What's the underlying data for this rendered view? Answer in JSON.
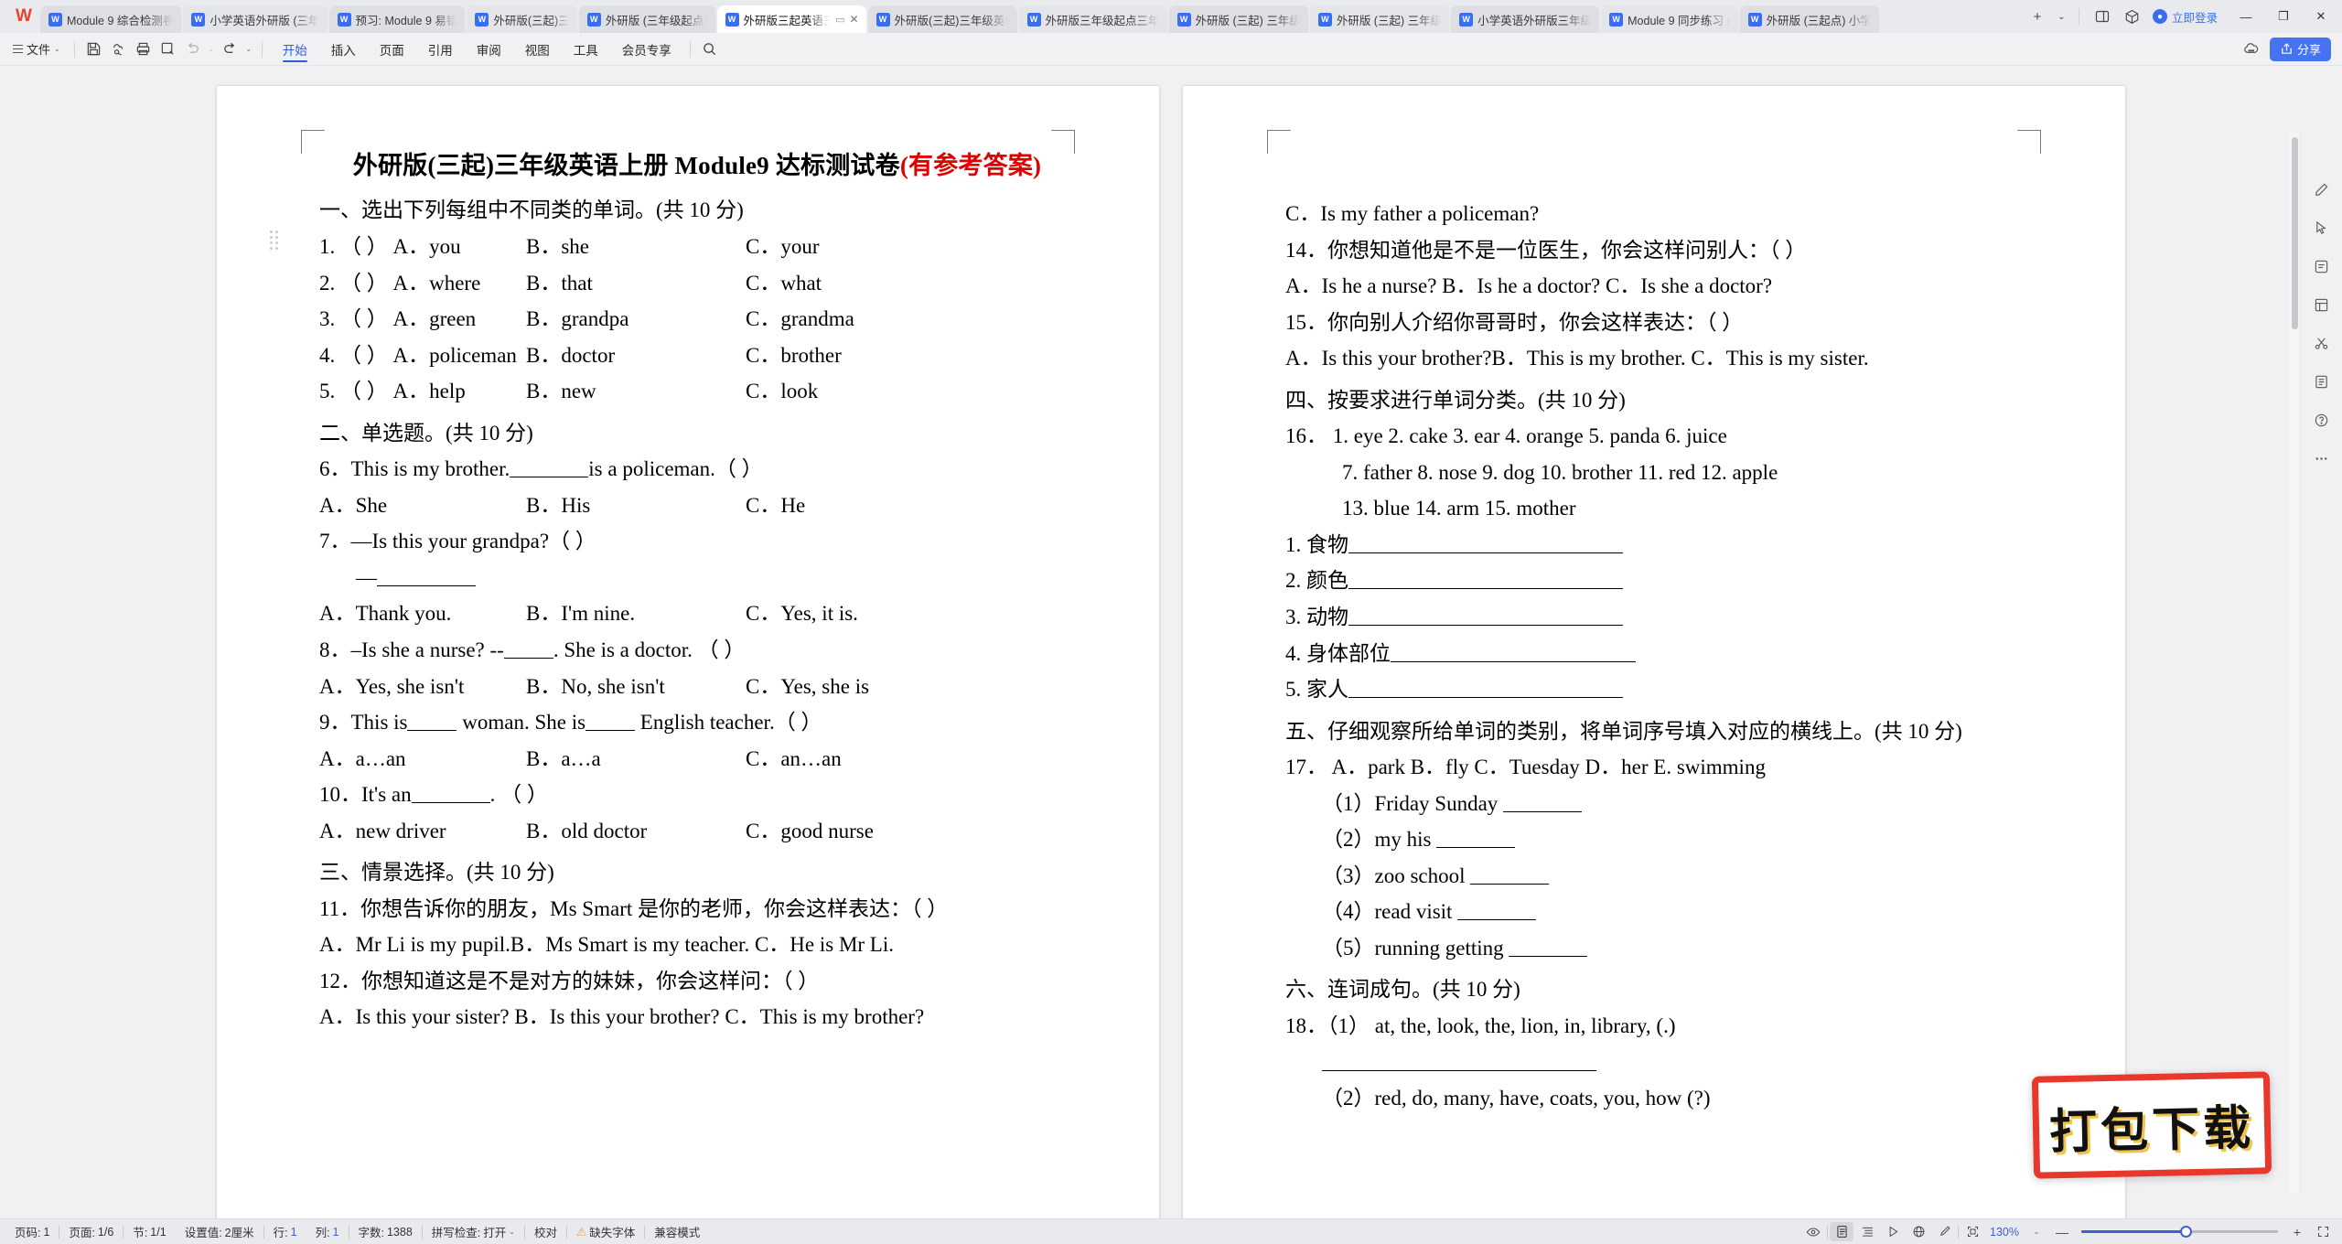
{
  "app": {
    "logo": "W"
  },
  "tabbar": {
    "tabs": [
      {
        "label": "Module 9 综合检测卷",
        "icon": "word-doc-icon",
        "active": false
      },
      {
        "label": "小学英语外研版 (三年",
        "icon": "word-doc-icon",
        "active": false
      },
      {
        "label": "预习: Module 9 易错",
        "icon": "word-doc-icon",
        "active": false
      },
      {
        "label": "外研版(三起)三",
        "icon": "word-doc-icon",
        "active": false
      },
      {
        "label": "外研版 (三年级起点)",
        "icon": "word-doc-icon",
        "active": false
      },
      {
        "label": "外研版三起英语三年",
        "icon": "word-doc-icon",
        "active": true
      },
      {
        "label": "外研版(三起)三年级英语",
        "icon": "word-doc-icon",
        "active": false
      },
      {
        "label": "外研版三年级起点三年",
        "icon": "word-doc-icon",
        "active": false
      },
      {
        "label": "外研版 (三起) 三年级",
        "icon": "word-doc-icon",
        "active": false
      },
      {
        "label": "外研版 (三起) 三年级",
        "icon": "word-doc-icon",
        "active": false
      },
      {
        "label": "小学英语外研版三年级",
        "icon": "word-doc-icon",
        "active": false
      },
      {
        "label": "Module 9 同步练习 (",
        "icon": "word-doc-icon",
        "active": false
      },
      {
        "label": "外研版 (三起点) 小学",
        "icon": "word-doc-icon",
        "active": false
      }
    ],
    "new_tab": "+",
    "new_tab_caret": "⌄",
    "login_label": "立即登录",
    "minimize": "—",
    "restore": "❐",
    "close": "✕"
  },
  "ribbon": {
    "file_label": "文件",
    "menus": [
      {
        "label": "开始",
        "active": true
      },
      {
        "label": "插入",
        "active": false
      },
      {
        "label": "页面",
        "active": false
      },
      {
        "label": "引用",
        "active": false
      },
      {
        "label": "审阅",
        "active": false
      },
      {
        "label": "视图",
        "active": false
      },
      {
        "label": "工具",
        "active": false
      },
      {
        "label": "会员专享",
        "active": false
      }
    ],
    "share_label": "分享"
  },
  "document": {
    "title_main": "外研版(三起)三年级英语上册 Module9 达标测试卷",
    "title_answer": "(有参考答案)",
    "left_page": {
      "section1_head": "一、选出下列每组中不同类的单词。(共 10 分)",
      "q1": {
        "num": "1.",
        "paren": "（    ）",
        "a": "A．you",
        "b": "B．she",
        "c": "C．your"
      },
      "q2": {
        "num": "2.",
        "paren": "（ ）",
        "a": "A．where",
        "b": "B．that",
        "c": "C．what"
      },
      "q3": {
        "num": "3.",
        "paren": "（    ）",
        "a": "A．green",
        "b": "B．grandpa",
        "c": "C．grandma"
      },
      "q4": {
        "num": "4.",
        "paren": "（    ）",
        "a": "A．policeman",
        "b": "B．doctor",
        "c": "C．brother"
      },
      "q5": {
        "num": "5.",
        "paren": "（    ）",
        "a": "A．help",
        "b": "B．new",
        "c": "C．look"
      },
      "section2_head": "二、单选题。(共 10 分)",
      "q6_stem_a": "6．This is my brother.",
      "q6_stem_b": "is a policeman.（     ）",
      "q6_a": "A．She",
      "q6_b": "B．His",
      "q6_c": "C．He",
      "q7_stem": "7．—Is this your grandpa?（ ）",
      "q7_dash": "—",
      "q7_a": "A．Thank you.",
      "q7_b": "B．I'm nine.",
      "q7_c": "C．Yes, it is.",
      "q8_stem_a": "8．–Is she a nurse? --",
      "q8_stem_b": ". She is a doctor. （   ）",
      "q8_a": "A．Yes, she isn't",
      "q8_b": "B．No, she isn't",
      "q8_c": "C．Yes, she is",
      "q9_stem_a": "9．This is",
      "q9_stem_b": "woman. She is",
      "q9_stem_c": "English teacher.（    ）",
      "q9_a": "A．a…an",
      "q9_b": "B．a…a",
      "q9_c": "C．an…an",
      "q10_stem_a": "10．It's an",
      "q10_stem_b": ".  （    ）",
      "q10_a": "A．new driver",
      "q10_b": "B．old doctor",
      "q10_c": "C．good nurse",
      "section3_head": "三、情景选择。(共 10 分)",
      "q11_stem": "11．你想告诉你的朋友，Ms Smart 是你的老师，你会这样表达：（ ）",
      "q11_opts": "A．Mr Li is my pupil.B．Ms Smart is my teacher. C．He is Mr Li.",
      "q12_stem": "12．你想知道这是不是对方的妹妹，你会这样问：（ ）",
      "q12_opts": "A．Is this your sister? B．Is this your brother? C．This is my brother?"
    },
    "right_page": {
      "q13_c": "C．Is my father a policeman?",
      "q14_stem": "14．你想知道他是不是一位医生，你会这样问别人：（ ）",
      "q14_opts": "A．Is he a nurse?   B．Is he a doctor?    C．Is she a doctor?",
      "q15_stem": "15．你向别人介绍你哥哥时，你会这样表达：（ ）",
      "q15_opts": "A．Is this your brother?B．This is my brother. C．This is my sister.",
      "section4_head": "四、按要求进行单词分类。(共 10 分)",
      "q16_num": "16．",
      "q16_row1": "1. eye      2. cake    3. ear     4. orange     5. panda  6. juice",
      "q16_row2": "7. father   8. nose    9. dog   10. brother    11. red    12. apple",
      "q16_row3": "13. blue   14. arm   15. mother",
      "cat1": "1. 食物",
      "cat2": "2. 颜色",
      "cat3": "3. 动物",
      "cat4": "4. 身体部位",
      "cat5": "5. 家人",
      "section5_head": "五、仔细观察所给单词的类别，将单词序号填入对应的横线上。(共 10 分)",
      "q17_stem": "17．  A．park   B．fly   C．Tuesday   D．her   E. swimming",
      "q17_1": "（1）Friday Sunday",
      "q17_2": "（2）my his",
      "q17_3": "（3）zoo school",
      "q17_4": "（4）read visit",
      "q17_5": "（5）running getting",
      "section6_head": "六、连词成句。(共 10 分)",
      "q18_1": "18．（1） at, the, look, the, lion, in, library,   (.)",
      "q18_2": "（2）red, do, many, have, coats, you, how     (?)"
    }
  },
  "watermark": {
    "label": "打包下载"
  },
  "statusbar": {
    "page_label": "页码:",
    "page_value": "1",
    "pages_label": "页面:",
    "pages_value": "1/6",
    "section_label": "节:",
    "section_value": "1/1",
    "setting_label": "设置值:",
    "setting_value": "2厘米",
    "row_label": "行:",
    "row_value": "1",
    "col_label": "列:",
    "col_value": "1",
    "words_label": "字数:",
    "words_value": "1388",
    "spell_label": "拼写检查:",
    "spell_value": "打开",
    "proof_label": "校对",
    "missing_font": "缺失字体",
    "compat_mode": "兼容模式",
    "zoom_value": "130%",
    "zoom_minus": "—",
    "zoom_plus": "+"
  }
}
